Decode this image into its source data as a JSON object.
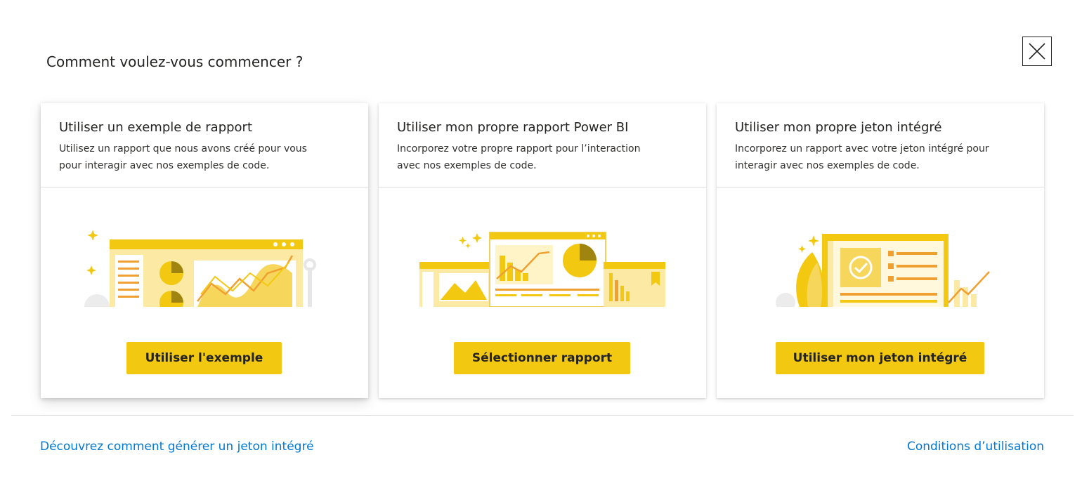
{
  "dialog": {
    "title": "Comment voulez-vous commencer ?",
    "close_icon": "close-icon"
  },
  "cards": [
    {
      "title": "Utiliser un exemple de rapport",
      "description_line1": "Utilisez un rapport que nous avons créé pour vous",
      "description_line2": "pour interagir avec nos exemples de code.",
      "button_label": "Utiliser l'exemple",
      "illustration": "sample-report-illustration"
    },
    {
      "title": "Utiliser mon propre rapport Power BI",
      "description_line1": "Incorporez votre propre rapport pour l’interaction",
      "description_line2": "avec nos exemples de code.",
      "button_label": "Sélectionner rapport",
      "illustration": "own-report-illustration"
    },
    {
      "title": "Utiliser mon propre jeton intégré",
      "description_line1": "Incorporez un rapport avec votre jeton intégré pour",
      "description_line2": "interagir avec nos exemples de code.",
      "button_label": "Utiliser mon jeton intégré",
      "illustration": "embed-token-illustration"
    }
  ],
  "footer": {
    "learn_link": "Découvrez comment générer un jeton intégré",
    "terms_link": "Conditions d’utilisation"
  },
  "colors": {
    "accent": "#f2c811",
    "link": "#0078d4",
    "text": "#252423"
  }
}
